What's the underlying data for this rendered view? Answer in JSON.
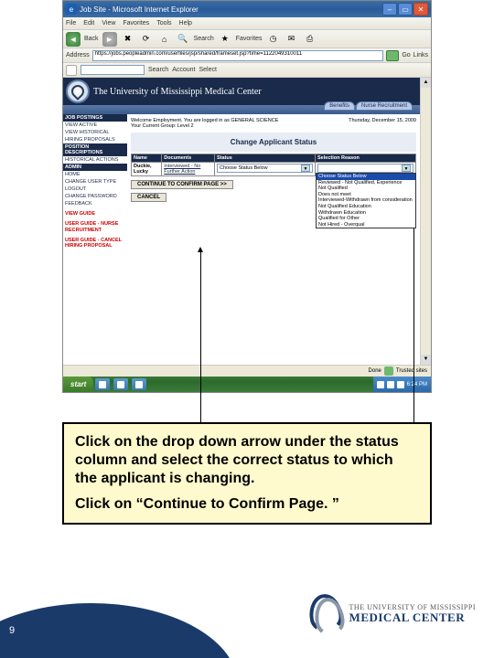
{
  "window": {
    "title": "Job Site - Microsoft Internet Explorer",
    "menu": [
      "File",
      "Edit",
      "View",
      "Favorites",
      "Tools",
      "Help"
    ],
    "toolbar": {
      "back": "Back",
      "search": "Search",
      "favorites": "Favorites"
    },
    "address_label": "Address",
    "url": "https://jobs.peopleadmin.com/userfiles/jsp/shared/frameset.jsp?time=1122049310011",
    "go": "Go",
    "links": "Links",
    "gbar": {
      "search": "Search",
      "account": "Account",
      "select": "Select"
    },
    "status": {
      "done": "Done",
      "zone": "Trusted sites"
    }
  },
  "banner": {
    "title": "The University of Mississippi Medical Center",
    "tabs": [
      "Benefits",
      "Nurse Recruitment"
    ]
  },
  "leftnav": {
    "sections": [
      {
        "header": "JOB POSTINGS",
        "items": [
          "VIEW ACTIVE",
          "VIEW HISTORICAL",
          "HIRING PROPOSALS"
        ]
      },
      {
        "header": "POSITION DESCRIPTIONS",
        "items": [
          "HISTORICAL ACTIONS"
        ]
      },
      {
        "header": "ADMIN",
        "items": [
          "HOME",
          "CHANGE USER TYPE",
          "LOGOUT",
          "CHANGE PASSWORD",
          "FEEDBACK"
        ]
      }
    ],
    "red_items": [
      "VIEW GUIDE",
      "USER GUIDE - NURSE RECRUITMENT",
      "USER GUIDE - CANCEL HIRING PROPOSAL"
    ]
  },
  "main": {
    "welcome": "Welcome Employment. You are logged in as GENERAL SCIENCE",
    "group": "Your Current Group: Level 2",
    "date": "Thursday, December 15, 2009",
    "heading": "Change Applicant Status",
    "columns": [
      "Name",
      "Documents",
      "Status",
      "Selection Reason"
    ],
    "row": {
      "name": "Duckie, Lucky",
      "doc": "Interviewed - No Further Action",
      "status_selected": "Choose Status Below",
      "reason_selected": ""
    },
    "dropdown_options": [
      "Choose Status Below",
      "Reviewed - Not Qualified, Experience",
      "Not Qualified",
      "Does not meet",
      "Interviewed-Withdrawn from consideration",
      "Not Qualified Education",
      "Withdrawn Education",
      "Qualified for Other",
      "Not Hired - Overqual"
    ],
    "buttons": {
      "continue": "CONTINUE TO CONFIRM PAGE >>",
      "cancel": "CANCEL"
    }
  },
  "taskbar": {
    "start": "start",
    "clock": "6:24 PM"
  },
  "instruction": {
    "p1": "Click on the drop down arrow under the status column and select the correct status to which the applicant is changing.",
    "p2": "Click on “Continue to Confirm Page. ”"
  },
  "footer": {
    "page": "9",
    "org_line1": "THE UNIVERSITY OF MISSISSIPPI",
    "org_line2": "MEDICAL CENTER"
  }
}
